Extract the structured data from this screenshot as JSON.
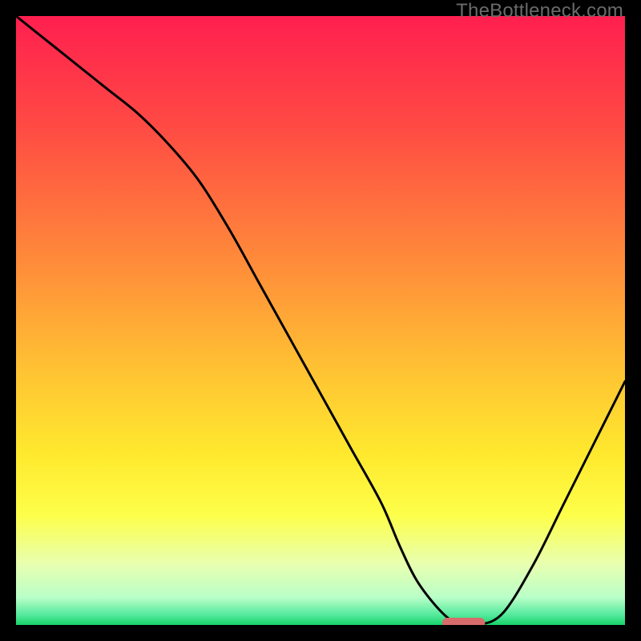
{
  "watermark": "TheBottleneck.com",
  "chart_data": {
    "type": "line",
    "title": "",
    "xlabel": "",
    "ylabel": "",
    "xlim": [
      0,
      100
    ],
    "ylim": [
      0,
      100
    ],
    "grid": false,
    "legend": false,
    "series": [
      {
        "name": "bottleneck-curve",
        "x": [
          0,
          5,
          10,
          15,
          20,
          25,
          30,
          35,
          40,
          45,
          50,
          55,
          60,
          63,
          66,
          70,
          73,
          76,
          80,
          85,
          90,
          95,
          100
        ],
        "y": [
          100,
          96,
          92,
          88,
          84,
          79,
          73,
          65,
          56,
          47,
          38,
          29,
          20,
          13,
          7,
          2,
          0,
          0,
          2,
          10,
          20,
          30,
          40
        ]
      }
    ],
    "marker": {
      "name": "optimal-range-marker",
      "x_start": 70,
      "x_end": 77,
      "y": 0,
      "color": "#d86b6b"
    },
    "background": {
      "type": "vertical-gradient",
      "stops": [
        {
          "pos": 0.0,
          "color": "#ff1f4f"
        },
        {
          "pos": 0.18,
          "color": "#ff4a44"
        },
        {
          "pos": 0.4,
          "color": "#ff8a3a"
        },
        {
          "pos": 0.58,
          "color": "#ffc233"
        },
        {
          "pos": 0.72,
          "color": "#ffe92e"
        },
        {
          "pos": 0.82,
          "color": "#fdff4a"
        },
        {
          "pos": 0.9,
          "color": "#e8ffb0"
        },
        {
          "pos": 0.955,
          "color": "#b9ffc8"
        },
        {
          "pos": 0.985,
          "color": "#4fe89a"
        },
        {
          "pos": 1.0,
          "color": "#17d268"
        }
      ]
    }
  }
}
